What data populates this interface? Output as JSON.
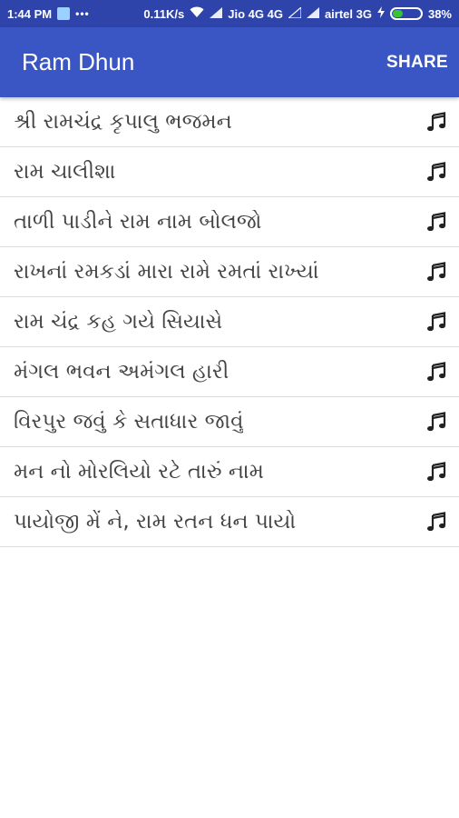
{
  "status_bar": {
    "time": "1:44 PM",
    "dots": "•••",
    "speed": "0.11K/s",
    "carrier1": "Jio 4G 4G",
    "carrier2": "airtel 3G",
    "battery": "38%",
    "battery_level": 0.38,
    "battery_color": "#36c436"
  },
  "app_bar": {
    "title": "Ram Dhun",
    "share_label": "SHARE",
    "color": "#3a55c4"
  },
  "songs": [
    {
      "title": "શ્રી રામચંદ્ર કૃપાલુ ભજમન",
      "icon": "music-note-icon"
    },
    {
      "title": "રામ ચાલીશા",
      "icon": "music-note-icon"
    },
    {
      "title": "તાળી પાડીને રામ નામ બોલજો",
      "icon": "music-note-icon"
    },
    {
      "title": "રાખનાં રમકડાં મારા રામે રમતાં રાખ્યાં",
      "icon": "music-note-icon"
    },
    {
      "title": "રામ ચંદ્ર કહ ગયે સિયાસે",
      "icon": "music-note-icon"
    },
    {
      "title": "મંગલ ભવન અમંગલ  હારી",
      "icon": "music-note-icon"
    },
    {
      "title": "વિરપુર જવું કે સતાધાર જાવું",
      "icon": "music-note-icon"
    },
    {
      "title": "મન નો મોરલિયો રટે તારું નામ",
      "icon": "music-note-icon"
    },
    {
      "title": "પાયોજી મેં ને, રામ રતન ધન પાયો",
      "icon": "music-note-icon"
    }
  ]
}
